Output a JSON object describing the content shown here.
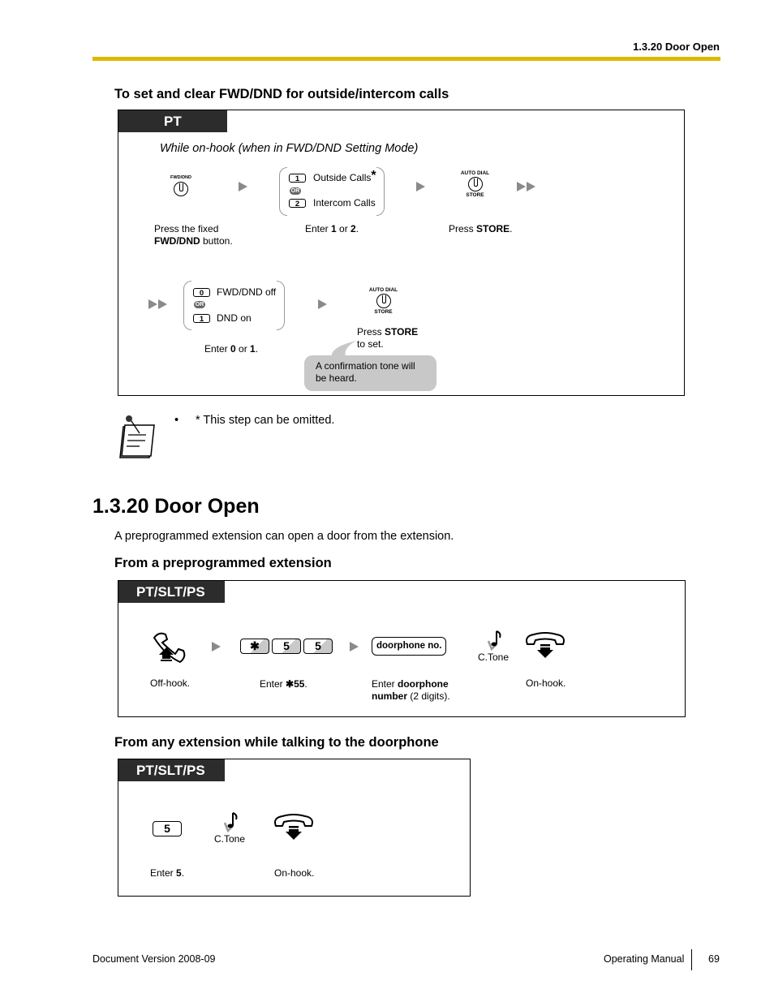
{
  "header": {
    "section_title": "1.3.20 Door Open",
    "rule_color": "#e0b800"
  },
  "fwd_dnd": {
    "heading": "To set and clear FWD/DND for outside/intercom calls",
    "tab": "PT",
    "condition": "While on-hook (when in FWD/DND Setting Mode)",
    "step1": {
      "button_label": "FWD/DND",
      "caption_prefix": "Press the fixed",
      "caption_bold": "FWD/DND",
      "caption_suffix": " button."
    },
    "step2": {
      "options": [
        {
          "key": "1",
          "label": "Outside Calls",
          "asterisk": "*"
        },
        {
          "key": "2",
          "label": "Intercom Calls"
        }
      ],
      "or_label": "OR",
      "caption_pre": "Enter ",
      "caption_b1": "1",
      "caption_mid": " or ",
      "caption_b2": "2",
      "caption_end": "."
    },
    "step3": {
      "top_label": "AUTO DIAL",
      "bottom_label": "STORE",
      "caption_pre": "Press ",
      "caption_bold": "STORE",
      "caption_end": "."
    },
    "step4": {
      "options": [
        {
          "key": "0",
          "label": "FWD/DND off"
        },
        {
          "key": "1",
          "label": "DND on"
        }
      ],
      "or_label": "OR",
      "caption_pre": "Enter ",
      "caption_b1": "0",
      "caption_mid": " or ",
      "caption_b2": "1",
      "caption_end": "."
    },
    "step5": {
      "top_label": "AUTO DIAL",
      "bottom_label": "STORE",
      "caption_pre": "Press ",
      "caption_bold": "STORE",
      "caption_line2": "to set."
    },
    "callout": "A confirmation tone will be heard."
  },
  "note": {
    "bullet": "•",
    "text": "* This step can be omitted."
  },
  "door_open": {
    "title": "1.3.20  Door Open",
    "description": "A preprogrammed extension can open a door from the extension.",
    "sub1": {
      "heading": "From a preprogrammed extension",
      "tab": "PT/SLT/PS",
      "offhook_caption": "Off-hook.",
      "keys": [
        "✱",
        "5",
        "5"
      ],
      "keys_caption_pre": "Enter ",
      "keys_caption_bold": "✱55",
      "keys_caption_end": ".",
      "doorphone_key": "doorphone no.",
      "doorphone_caption_pre": "Enter ",
      "doorphone_caption_bold1": "doorphone",
      "doorphone_caption_bold2": "number",
      "doorphone_caption_end": " (2 digits).",
      "tone_label": "C.Tone",
      "onhook_caption": "On-hook."
    },
    "sub2": {
      "heading": "From any extension while talking to the doorphone",
      "tab": "PT/SLT/PS",
      "key": "5",
      "key_caption_pre": "Enter ",
      "key_caption_bold": "5",
      "key_caption_end": ".",
      "tone_label": "C.Tone",
      "onhook_caption": "On-hook."
    }
  },
  "footer": {
    "version": "Document Version  2008-09",
    "manual": "Operating Manual",
    "page": "69"
  }
}
